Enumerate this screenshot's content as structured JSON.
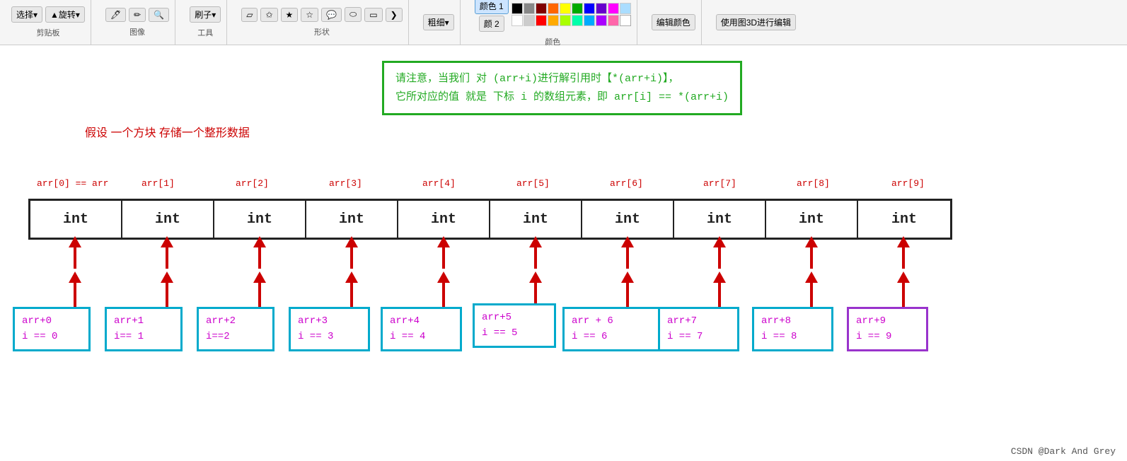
{
  "toolbar": {
    "sections": [
      {
        "label": "剪贴板",
        "items": [
          "选择▾",
          "旋转▾"
        ]
      },
      {
        "label": "图像",
        "items": [
          "🖌",
          "✏",
          "🔍"
        ]
      },
      {
        "label": "工具",
        "items": [
          "刷子▾"
        ]
      },
      {
        "label": "形状",
        "items": [
          "▱",
          "☆",
          "★",
          "✩",
          "☁",
          "⬭",
          "▭",
          "❯"
        ]
      },
      {
        "label": "",
        "items": [
          "粗细▾"
        ]
      },
      {
        "label": "颜色",
        "items": [
          "颜色1",
          "颜色2"
        ]
      },
      {
        "label": "",
        "items": [
          "编辑颜色"
        ]
      },
      {
        "label": "",
        "items": [
          "使用图3D进行编辑"
        ]
      }
    ],
    "color1_label": "颜色 1",
    "color2_label": "颜 2"
  },
  "note": {
    "line1": "请注意，当我们 对 (arr+i)进行解引用时【*(arr+i)】，",
    "line2": "它所对应的值 就是 下标 i 的数组元素，即 arr[i] == *(arr+i)"
  },
  "hypothesis": "假设 一个方块 存储一个整形数据",
  "array_labels": [
    "arr[0] == arr",
    "arr[1]",
    "arr[2]",
    "arr[3]",
    "arr[4]",
    "arr[5]",
    "arr[6]",
    "arr[7]",
    "arr[8]",
    "arr[9]"
  ],
  "array_cells": [
    "int",
    "int",
    "int",
    "int",
    "int",
    "int",
    "int",
    "int",
    "int",
    "int"
  ],
  "addr_boxes": [
    {
      "line1": "arr+0",
      "line2": "i == 0",
      "type": "cyan"
    },
    {
      "line1": "arr+1",
      "line2": "i== 1",
      "type": "cyan"
    },
    {
      "line1": "arr+2",
      "line2": "i==2",
      "type": "cyan"
    },
    {
      "line1": "arr+3",
      "line2": "i == 3",
      "type": "cyan"
    },
    {
      "line1": "arr+4",
      "line2": "i == 4",
      "type": "cyan"
    },
    {
      "line1": "arr+5",
      "line2": "i == 5",
      "type": "cyan"
    },
    {
      "line1": "arr + 6",
      "line2": "i == 6",
      "type": "cyan"
    },
    {
      "line1": "arr+7",
      "line2": "i == 7",
      "type": "cyan"
    },
    {
      "line1": "arr+8",
      "line2": "i == 8",
      "type": "cyan"
    },
    {
      "line1": "arr+9",
      "line2": "i == 9",
      "type": "purple"
    }
  ],
  "footer": "CSDN @Dark And Grey"
}
